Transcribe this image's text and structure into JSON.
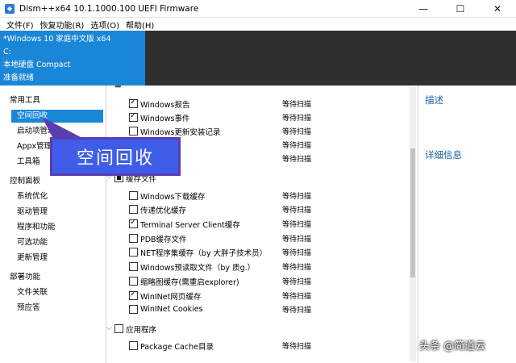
{
  "window": {
    "title": "Dism++x64 10.1.1000.100 UEFI Firmware",
    "minimize": "—",
    "maximize": "☐",
    "close": "✕"
  },
  "menu": [
    "文件(F)",
    "恢复功能(R)",
    "选项(O)",
    "帮助(H)"
  ],
  "system_info": {
    "os": "*Windows 10 家庭中文版 x64",
    "drive": "C:",
    "disk": "本地硬盘 Compact",
    "status": "准备就绪"
  },
  "sidebar": {
    "groups": [
      "常用工具",
      "控制面板",
      "部署功能"
    ],
    "tools": [
      "空间回收",
      "启动项管理",
      "Appx管理",
      "工具箱"
    ],
    "control": [
      "系统优化",
      "驱动管理",
      "程序和功能",
      "可选功能",
      "更新管理"
    ],
    "deploy": [
      "文件关联",
      "预应答"
    ]
  },
  "list": {
    "status_wait": "等待扫描",
    "items": [
      {
        "label": "Windows报告",
        "checked": true
      },
      {
        "label": "Windows事件",
        "checked": true
      },
      {
        "label": "Windows更新安装记录",
        "checked": false
      },
      {
        "label": "",
        "checked": false
      },
      {
        "label": "",
        "checked": false
      },
      {
        "label": "缓存文件",
        "group": true
      },
      {
        "label": "Windows下载缓存",
        "checked": false
      },
      {
        "label": "传递优化缓存",
        "checked": false
      },
      {
        "label": "Terminal Server Client缓存",
        "checked": true
      },
      {
        "label": "PDB缓存文件",
        "checked": false
      },
      {
        "label": "NET程序集缓存（by 大胖子技术员）",
        "checked": false
      },
      {
        "label": "Windows预读取文件（by 质g.）",
        "checked": false
      },
      {
        "label": "缩略图缓存(需重启explorer)",
        "checked": false
      },
      {
        "label": "WinINet网页缓存",
        "checked": true
      },
      {
        "label": "WinINet Cookies",
        "checked": false
      },
      {
        "label": "应用程序",
        "group": true
      },
      {
        "label": "Package Cache目录",
        "checked": false
      }
    ]
  },
  "right_panel": {
    "description": "描述",
    "details": "详细信息"
  },
  "overlay": {
    "callout": "空间回收"
  },
  "watermark": "头条 @简道云",
  "colors": {
    "accent": "#1a86d8",
    "callout": "#3f5de8"
  }
}
